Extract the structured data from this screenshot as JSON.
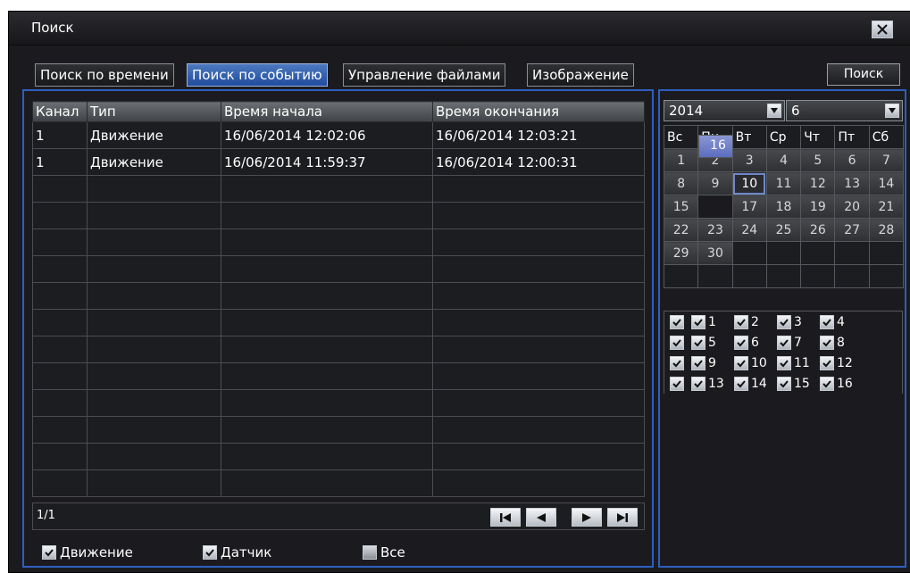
{
  "window": {
    "title": "Поиск"
  },
  "tabs": [
    {
      "label": "Поиск по времени",
      "active": false
    },
    {
      "label": "Поиск по событию",
      "active": true
    },
    {
      "label": "Управление файлами",
      "active": false
    },
    {
      "label": "Изображение",
      "active": false
    }
  ],
  "search_button": "Поиск",
  "table": {
    "headers": [
      "Канал",
      "Тип",
      "Время начала",
      "Время окончания"
    ],
    "rows": [
      [
        "1",
        "Движение",
        "16/06/2014 12:02:06",
        "16/06/2014 12:03:21"
      ],
      [
        "1",
        "Движение",
        "16/06/2014 11:59:37",
        "16/06/2014 12:00:31"
      ]
    ],
    "empty_rows": 12
  },
  "pagination": {
    "page_info": "1/1"
  },
  "filters": [
    {
      "label": "Движение",
      "checked": true
    },
    {
      "label": "Датчик",
      "checked": true
    },
    {
      "label": "Все",
      "checked": false
    }
  ],
  "calendar": {
    "year": "2014",
    "month": "6",
    "weekdays": [
      "Вс",
      "Пн",
      "Вт",
      "Ср",
      "Чт",
      "Пт",
      "Сб"
    ],
    "weeks": [
      [
        "1",
        "2",
        "3",
        "4",
        "5",
        "6",
        "7"
      ],
      [
        "8",
        "9",
        "10",
        "11",
        "12",
        "13",
        "14"
      ],
      [
        "15",
        "16",
        "17",
        "18",
        "19",
        "20",
        "21"
      ],
      [
        "22",
        "23",
        "24",
        "25",
        "26",
        "27",
        "28"
      ],
      [
        "29",
        "30",
        "",
        "",
        "",
        "",
        ""
      ],
      [
        "",
        "",
        "",
        "",
        "",
        "",
        ""
      ]
    ],
    "today_day": "10",
    "selected_day": "16"
  },
  "channels": {
    "rows": [
      [
        "1",
        "2",
        "3",
        "4"
      ],
      [
        "5",
        "6",
        "7",
        "8"
      ],
      [
        "9",
        "10",
        "11",
        "12"
      ],
      [
        "13",
        "14",
        "15",
        "16"
      ]
    ],
    "all_checked": true
  },
  "colors": {
    "accent": "#2f5fbf",
    "active_tab": "#3a66b0",
    "selected_day": "#7080cc"
  }
}
